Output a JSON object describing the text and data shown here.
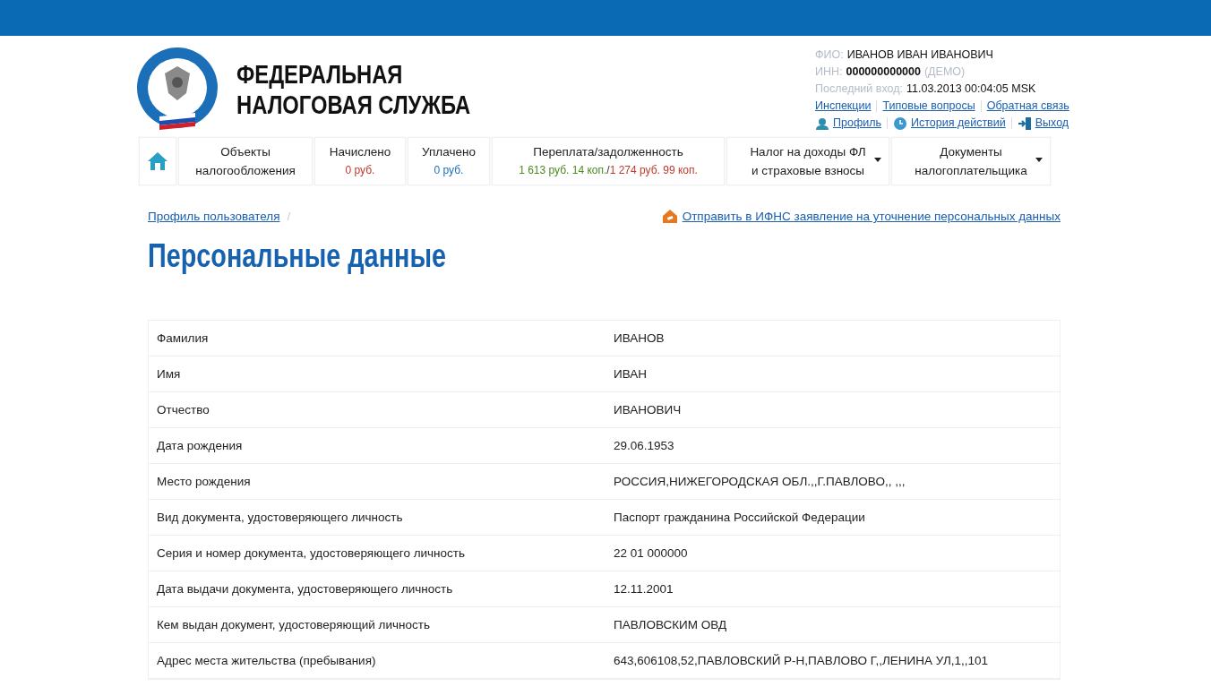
{
  "brand": {
    "line_1": "ФЕДЕРАЛЬНАЯ",
    "line_2": "НАЛОГОВАЯ СЛУЖБА"
  },
  "user": {
    "fio_label": "ФИО:",
    "fio": "ИВАНОВ ИВАН ИВАНОВИЧ",
    "inn_label": "ИНН:",
    "inn": "000000000000",
    "inn_note": "(ДЕМО)",
    "last_login_label": "Последний вход:",
    "last_login": "11.03.2013 00:04:05 MSK"
  },
  "top_links": [
    "Инспекции",
    "Типовые вопросы",
    "Обратная связь"
  ],
  "account_links": [
    {
      "kind": "profile",
      "label": "Профиль"
    },
    {
      "kind": "history",
      "label": "История действий"
    },
    {
      "kind": "logout",
      "label": "Выход"
    }
  ],
  "nav": [
    {
      "kind": "home"
    },
    {
      "kind": "plain",
      "lines": [
        "Объекты",
        "налогообложения"
      ]
    },
    {
      "kind": "amount",
      "title": "Начислено",
      "parts": [
        {
          "text": "0 руб.",
          "color": "#c0392b"
        }
      ]
    },
    {
      "kind": "amount",
      "title": "Уплачено",
      "parts": [
        {
          "text": "0 руб.",
          "color": "#1e6fbf"
        }
      ]
    },
    {
      "kind": "amount",
      "title": "Переплата/задолженность",
      "parts": [
        {
          "text": "1 613 руб. 14 коп.",
          "color": "#4e8a1e"
        },
        {
          "text": "/",
          "kind": "separator"
        },
        {
          "text": "1 274 руб. 99 коп.",
          "color": "#c0392b"
        }
      ]
    },
    {
      "kind": "dropdown",
      "lines": [
        "Налог на доходы ФЛ",
        "и страховые взносы"
      ]
    },
    {
      "kind": "dropdown",
      "lines": [
        "Документы",
        "налогоплательщика"
      ]
    }
  ],
  "breadcrumb": [
    "Профиль пользователя"
  ],
  "breadcrumb_separator": "/",
  "action_link": "Отправить в ИФНС заявление на уточнение персональных данных",
  "title": "Персональные данные",
  "table": {
    "rows": [
      [
        "Фамилия",
        "ИВАНОВ"
      ],
      [
        "Имя",
        "ИВАН"
      ],
      [
        "Отчество",
        "ИВАНОВИЧ"
      ],
      [
        "Дата рождения",
        "29.06.1953"
      ],
      [
        "Место рождения",
        "РОССИЯ,НИЖЕГОРОДСКАЯ ОБЛ.,,Г.ПАВЛОВО,, ,,,"
      ],
      [
        "Вид документа, удостоверяющего личность",
        "Паспорт гражданина Российской Федерации"
      ],
      [
        "Серия и номер документа, удостоверяющего личность",
        "22 01 000000"
      ],
      [
        "Дата выдачи документа, удостоверяющего личность",
        "12.11.2001"
      ],
      [
        "Кем выдан документ, удостоверяющий личность",
        "ПАВЛОВСКИМ ОВД"
      ],
      [
        "Адрес места жительства (пребывания)",
        "643,606108,52,ПАВЛОВСКИЙ Р-Н,ПАВЛОВО Г,,ЛЕНИНА УЛ,1,,101"
      ]
    ]
  }
}
